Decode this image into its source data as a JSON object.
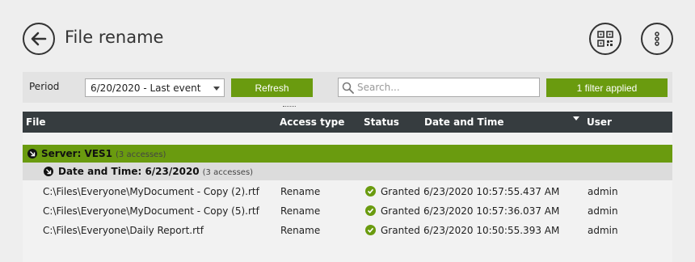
{
  "header": {
    "title": "File rename",
    "back_icon": "back-arrow-icon",
    "qr_icon": "qr-code-icon",
    "menu_icon": "more-vertical-icon"
  },
  "filter": {
    "period_label": "Period",
    "period_value": "6/20/2020 - Last event",
    "refresh_label": "Refresh",
    "search_placeholder": "Search...",
    "filter_label": "1 filter applied"
  },
  "colors": {
    "accent": "#6a9b0f",
    "header_bg": "#363c3f",
    "subgroup_bg": "#dcdcdc"
  },
  "grid": {
    "columns": [
      "File",
      "Access type",
      "Status",
      "Date and Time",
      "User"
    ],
    "server_group": {
      "label": "Server: VES1",
      "count": "(3 accesses)"
    },
    "date_group": {
      "label": "Date and Time: 6/23/2020",
      "count": "(3 accesses)"
    },
    "rows": [
      {
        "file": "C:\\Files\\Everyone\\MyDocument - Copy (2).rtf",
        "access": "Rename",
        "status": "Granted",
        "datetime": "6/23/2020 10:57:55.437 AM",
        "user": "admin"
      },
      {
        "file": "C:\\Files\\Everyone\\MyDocument - Copy (5).rtf",
        "access": "Rename",
        "status": "Granted",
        "datetime": "6/23/2020 10:57:36.037 AM",
        "user": "admin"
      },
      {
        "file": "C:\\Files\\Everyone\\Daily Report.rtf",
        "access": "Rename",
        "status": "Granted",
        "datetime": "6/23/2020 10:50:55.393 AM",
        "user": "admin"
      }
    ]
  }
}
